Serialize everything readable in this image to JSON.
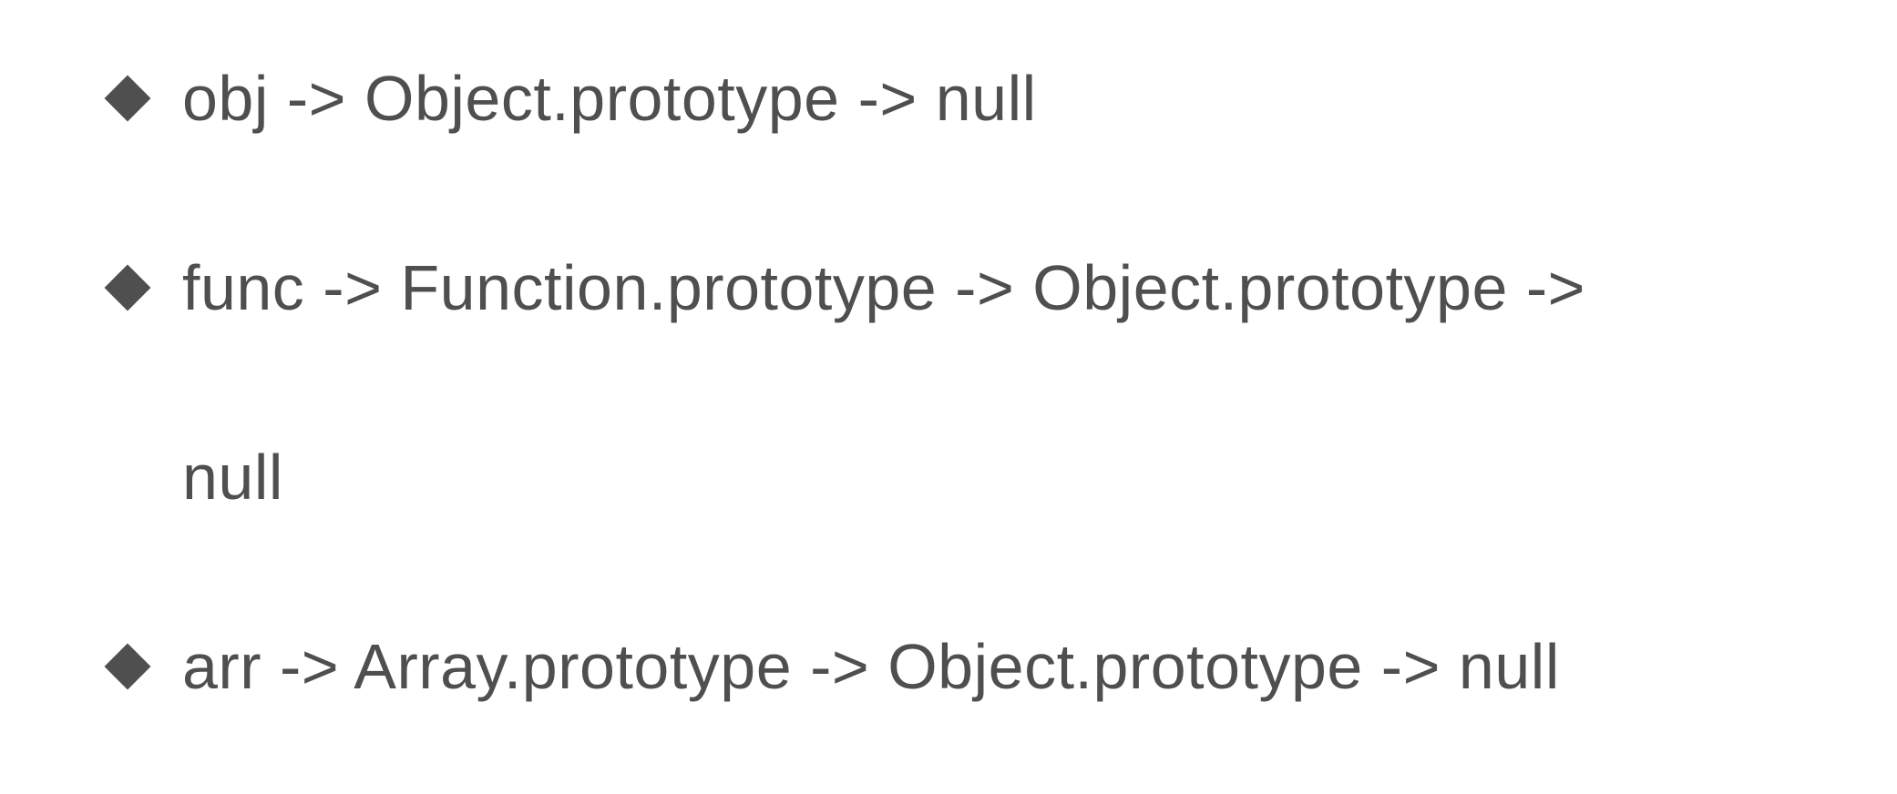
{
  "items": [
    {
      "text": "obj -> Object.prototype -> null"
    },
    {
      "text": "func -> Function.prototype -> Object.prototype ->"
    },
    {
      "text": "null"
    },
    {
      "text": "arr -> Array.prototype -> Object.prototype -> null"
    }
  ]
}
